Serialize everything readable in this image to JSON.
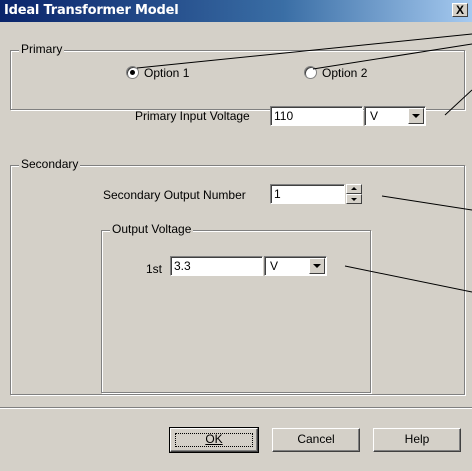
{
  "window": {
    "title": "Ideal Transformer Model",
    "close_label": "X"
  },
  "primary": {
    "legend": "Primary",
    "option1_label": "Option 1",
    "option2_label": "Option 2",
    "selected": "Option 1",
    "input_voltage_label": "Primary Input Voltage",
    "input_voltage_value": "110",
    "input_voltage_unit": "V"
  },
  "secondary": {
    "legend": "Secondary",
    "output_number_label": "Secondary Output Number",
    "output_number_value": "1",
    "output_voltage": {
      "legend": "Output Voltage",
      "row_label": "1st",
      "value": "3.3",
      "unit": "V"
    }
  },
  "buttons": {
    "ok_label": "OK",
    "cancel_label": "Cancel",
    "help_label": "Help"
  },
  "icons": [
    "close-icon",
    "dropdown-arrow-icon",
    "spin-up-icon",
    "spin-down-icon"
  ]
}
